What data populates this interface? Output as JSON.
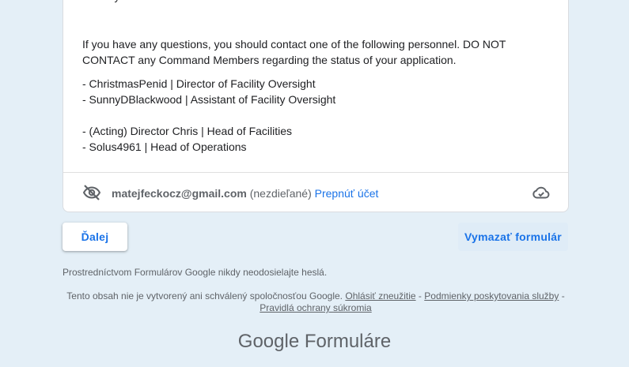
{
  "form": {
    "description_cut": "ursively",
    "contact_intro": "If you have any questions, you should contact one of the following personnel. DO NOT CONTACT any Command Members regarding the status of your application.",
    "personnel_group_1": [
      "-  ChristmasPenid | Director of Facility Oversight",
      "-  SunnyDBlackwood | Assistant of Facility Oversight"
    ],
    "personnel_group_2": [
      "- (Acting) Director Chris | Head of Facilities",
      "- Solus4961 | Head of Operations"
    ]
  },
  "account": {
    "email": "matejfeckocz@gmail.com",
    "status": "(nezdieľané)",
    "switch_label": "Prepnúť účet",
    "left_icon": "eye-off-icon",
    "right_icon": "cloud-done-icon"
  },
  "actions": {
    "next_label": "Ďalej",
    "clear_label": "Vymazať formulár"
  },
  "footer": {
    "never_password": "Prostredníctvom Formulárov Google nikdy neodosielajte heslá.",
    "disclaimer_prefix": "Tento obsah nie je vytvorený ani schválený spoločnosťou Google.",
    "report_abuse": "Ohlásiť zneužitie",
    "separator": "-",
    "terms": "Podmienky poskytovania služby",
    "privacy": "Pravidlá ochrany súkromia",
    "logo_google": "Google",
    "logo_product": "Formuláre"
  },
  "colors": {
    "background": "#e4eff7",
    "accent": "#1a73e8",
    "muted_text": "#5f6368"
  }
}
